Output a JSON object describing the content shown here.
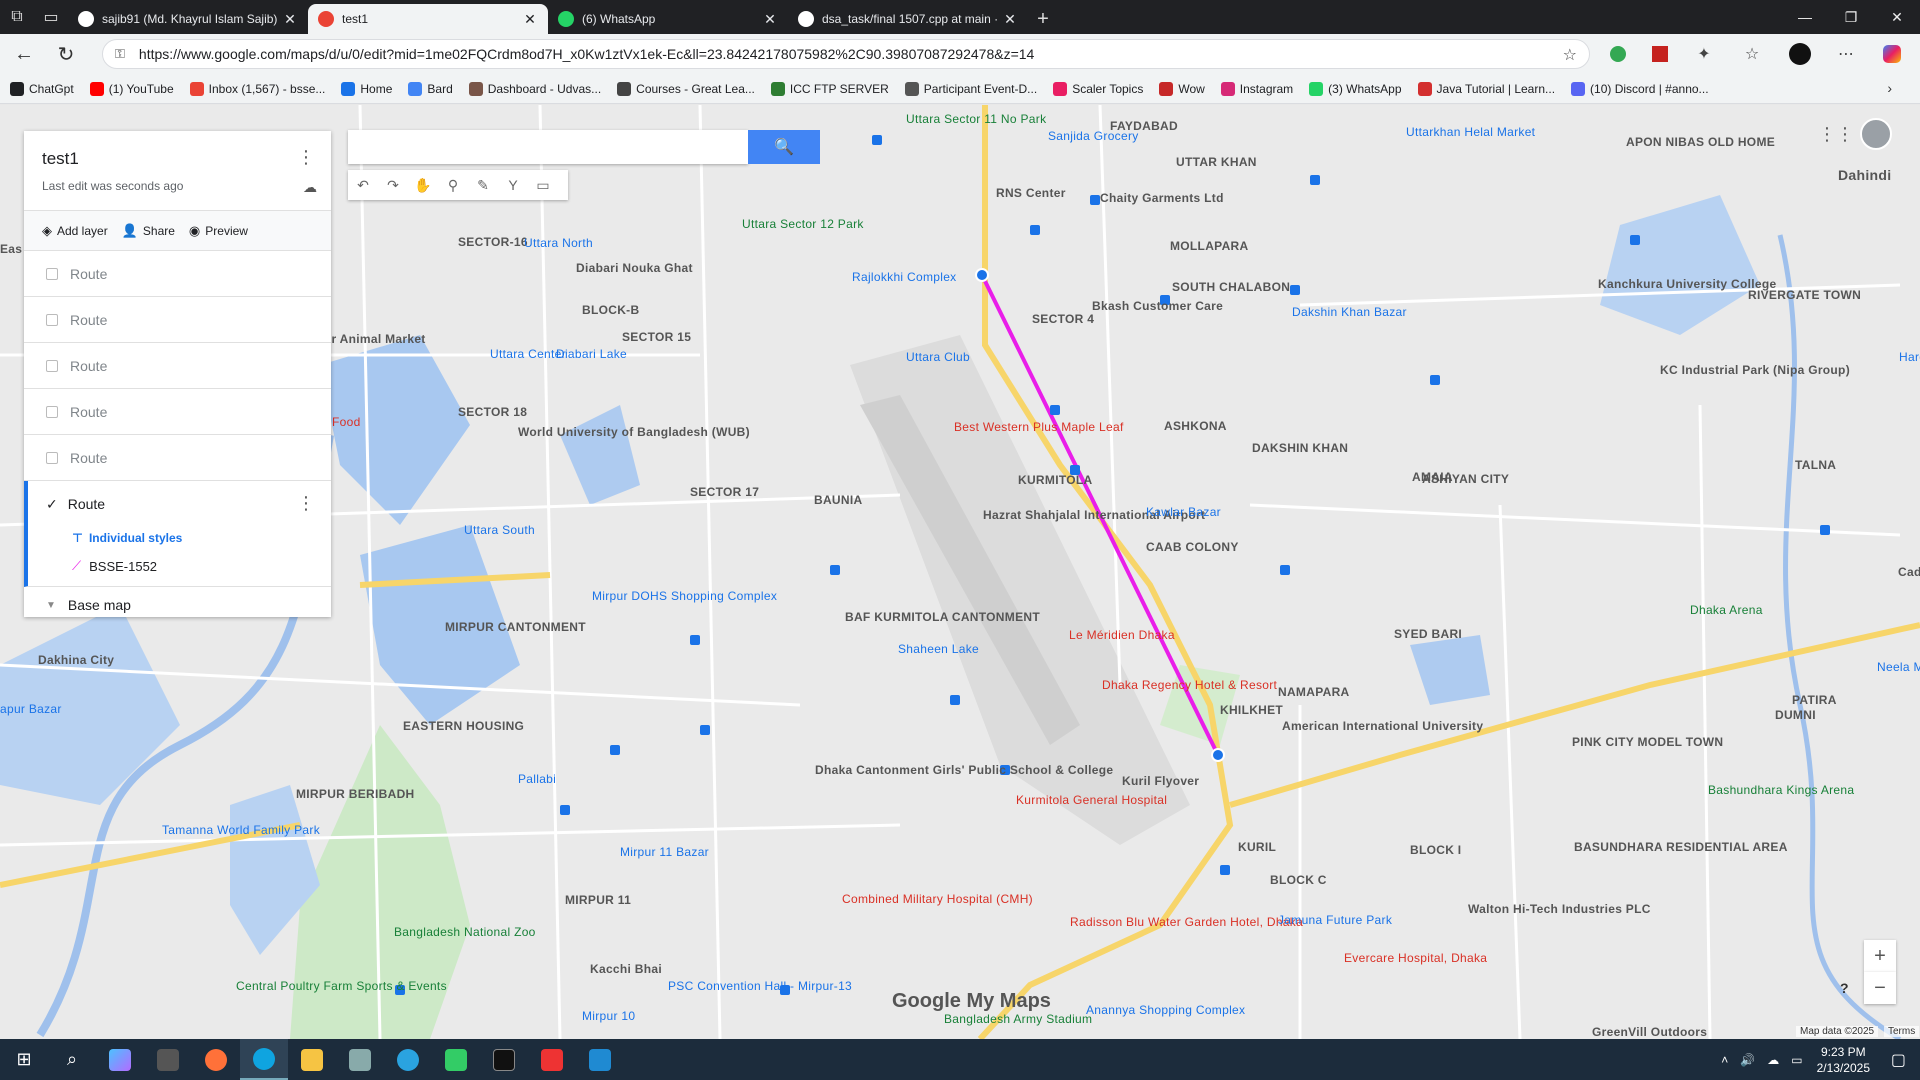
{
  "browser": {
    "tabs": [
      {
        "title": "sajib91 (Md. Khayrul Islam Sajib)",
        "icon": "github-icon",
        "color": "#ffffff",
        "active": false
      },
      {
        "title": "test1",
        "icon": "google-maps-icon",
        "color": "#ea4335",
        "active": true
      },
      {
        "title": "(6) WhatsApp",
        "icon": "whatsapp-icon",
        "color": "#25d366",
        "active": false
      },
      {
        "title": "dsa_task/final 1507.cpp at main · ",
        "icon": "github-icon",
        "color": "#ffffff",
        "active": false
      }
    ],
    "new_tab": "+",
    "url": "https://www.google.com/maps/d/u/0/edit?mid=1me02FQCrdm8od7H_x0Kw1ztVx1ek-Ec&ll=23.84242178075982%2C90.39807087292478&z=14",
    "bookmarks": [
      {
        "label": "ChatGpt",
        "color": "#202124"
      },
      {
        "label": "(1) YouTube",
        "color": "#ff0000"
      },
      {
        "label": "Inbox (1,567) - bsse...",
        "color": "#ea4335"
      },
      {
        "label": "Home",
        "color": "#1a73e8"
      },
      {
        "label": "Bard",
        "color": "#4285f4"
      },
      {
        "label": "Dashboard - Udvas...",
        "color": "#795548"
      },
      {
        "label": "Courses - Great Lea...",
        "color": "#444444"
      },
      {
        "label": "ICC FTP SERVER",
        "color": "#2e7d32"
      },
      {
        "label": "Participant Event-D...",
        "color": "#555555"
      },
      {
        "label": "Scaler Topics",
        "color": "#e91e63"
      },
      {
        "label": "Wow",
        "color": "#c62828"
      },
      {
        "label": "Instagram",
        "color": "#d62976"
      },
      {
        "label": "(3) WhatsApp",
        "color": "#25d366"
      },
      {
        "label": "Java Tutorial | Learn...",
        "color": "#d32f2f"
      },
      {
        "label": "(10) Discord | #anno...",
        "color": "#5865f2"
      }
    ]
  },
  "panel": {
    "title": "test1",
    "last_edit": "Last edit was seconds ago",
    "add_layer": "Add layer",
    "share": "Share",
    "preview": "Preview",
    "layers": [
      "Route",
      "Route",
      "Route",
      "Route",
      "Route"
    ],
    "active_layer": {
      "name": "Route",
      "style": "Individual styles",
      "feature": "BSSE-1552"
    },
    "base_map": "Base map"
  },
  "map": {
    "route_color": "#e91ee9",
    "areas": [
      {
        "text": "FAYDABAD",
        "cls": "area"
      },
      {
        "text": "UTTAR KHAN",
        "cls": "area"
      },
      {
        "text": "SECTOR-16",
        "cls": "area"
      },
      {
        "text": "BLOCK-B",
        "cls": "area"
      },
      {
        "text": "SECTOR 15",
        "cls": "area"
      },
      {
        "text": "SECTOR 4",
        "cls": "area"
      },
      {
        "text": "MOLLAPARA",
        "cls": "area"
      },
      {
        "text": "SOUTH CHALABON",
        "cls": "area"
      },
      {
        "text": "SECTOR 18",
        "cls": "area"
      },
      {
        "text": "ASHKONA",
        "cls": "area"
      },
      {
        "text": "KURMITOLA",
        "cls": "area"
      },
      {
        "text": "SECTOR 17",
        "cls": "area"
      },
      {
        "text": "BAUNIA",
        "cls": "area"
      },
      {
        "text": "CAAB COLONY",
        "cls": "area"
      },
      {
        "text": "AMAIA",
        "cls": "area"
      },
      {
        "text": "TALNA",
        "cls": "area"
      },
      {
        "text": "BAF KURMITOLA CANTONMENT",
        "cls": "area"
      },
      {
        "text": "MIRPUR CANTONMENT",
        "cls": "area"
      },
      {
        "text": "SYED BARI",
        "cls": "area"
      },
      {
        "text": "NAMAPARA",
        "cls": "area"
      },
      {
        "text": "KHILKHET",
        "cls": "area"
      },
      {
        "text": "EASTERN HOUSING",
        "cls": "area"
      },
      {
        "text": "PINK CITY MODEL TOWN",
        "cls": "area"
      },
      {
        "text": "PATIRA",
        "cls": "area"
      },
      {
        "text": "MIRPUR BERIBADH",
        "cls": "area"
      },
      {
        "text": "KURIL",
        "cls": "area"
      },
      {
        "text": "BLOCK I",
        "cls": "area"
      },
      {
        "text": "BLOCK C",
        "cls": "area"
      },
      {
        "text": "MIRPUR 11",
        "cls": "area"
      },
      {
        "text": "RIVERGATE TOWN",
        "cls": "area"
      },
      {
        "text": "Dahindi",
        "cls": "big"
      },
      {
        "text": "APON NIBAS OLD HOME",
        "cls": "area"
      }
    ],
    "pois": [
      {
        "text": "Uttara Sector 11 No Park",
        "cls": "green"
      },
      {
        "text": "Sanjida Grocery",
        "cls": "poi"
      },
      {
        "text": "Uttarkhan Helal Market",
        "cls": "poi"
      },
      {
        "text": "RNS Center",
        "cls": "area"
      },
      {
        "text": "Chaity Garments Ltd",
        "cls": "area"
      },
      {
        "text": "Uttara Sector 12 Park",
        "cls": "green"
      },
      {
        "text": "Uttara North",
        "cls": "poi"
      },
      {
        "text": "Diabari Nouka Ghat",
        "cls": "area"
      },
      {
        "text": "Rajlokkhi Complex",
        "cls": "poi"
      },
      {
        "text": "Bkash Customer Care",
        "cls": "area"
      },
      {
        "text": "Dakshin Khan Bazar",
        "cls": "poi"
      },
      {
        "text": "Kanchkura University College",
        "cls": "area"
      },
      {
        "text": "Uttara Center",
        "cls": "poi"
      },
      {
        "text": "Diabari Lake",
        "cls": "poi"
      },
      {
        "text": "Uttara Club",
        "cls": "poi"
      },
      {
        "text": "KC Industrial Park (Nipa Group)",
        "cls": "area"
      },
      {
        "text": "Best Western Plus Maple Leaf",
        "cls": "red"
      },
      {
        "text": "World University of Bangladesh (WUB)",
        "cls": "area"
      },
      {
        "text": "DAKSHIN KHAN",
        "cls": "area"
      },
      {
        "text": "ASHIYAN CITY",
        "cls": "area"
      },
      {
        "text": "Hazrat Shahjalal International Airport",
        "cls": "area"
      },
      {
        "text": "Kawlar Bazar",
        "cls": "poi"
      },
      {
        "text": "Uttara South",
        "cls": "poi"
      },
      {
        "text": "Mirpur DOHS Shopping Complex",
        "cls": "poi"
      },
      {
        "text": "Le Méridien Dhaka",
        "cls": "red"
      },
      {
        "text": "Dhaka Arena",
        "cls": "green"
      },
      {
        "text": "Dakhina City",
        "cls": "area"
      },
      {
        "text": "Shaheen Lake",
        "cls": "poi"
      },
      {
        "text": "Dhaka Regency Hotel & Resort",
        "cls": "red"
      },
      {
        "text": "American International University",
        "cls": "area"
      },
      {
        "text": "Pallabi",
        "cls": "poi"
      },
      {
        "text": "Dhaka Cantonment Girls' Public School & College",
        "cls": "area"
      },
      {
        "text": "Kurmitola General Hospital",
        "cls": "red"
      },
      {
        "text": "Kuril Flyover",
        "cls": "area"
      },
      {
        "text": "Bashundhara Kings Arena",
        "cls": "green"
      },
      {
        "text": "Tamanna World Family Park",
        "cls": "poi"
      },
      {
        "text": "Mirpur 11 Bazar",
        "cls": "poi"
      },
      {
        "text": "Combined Military Hospital (CMH)",
        "cls": "red"
      },
      {
        "text": "Radisson Blu Water Garden Hotel, Dhaka",
        "cls": "red"
      },
      {
        "text": "Jamuna Future Park",
        "cls": "poi"
      },
      {
        "text": "Walton Hi-Tech Industries PLC",
        "cls": "area"
      },
      {
        "text": "Bangladesh National Zoo",
        "cls": "green"
      },
      {
        "text": "Kacchi Bhai",
        "cls": "area"
      },
      {
        "text": "Evercare Hospital, Dhaka",
        "cls": "red"
      },
      {
        "text": "Central Poultry Farm Sports & Events",
        "cls": "green"
      },
      {
        "text": "PSC Convention Hall - Mirpur-13",
        "cls": "poi"
      },
      {
        "text": "Mirpur 10",
        "cls": "poi"
      },
      {
        "text": "Bangladesh Army Stadium",
        "cls": "green"
      },
      {
        "text": "Anannya Shopping Complex",
        "cls": "poi"
      },
      {
        "text": "BASUNDHARA RESIDENTIAL AREA",
        "cls": "area"
      },
      {
        "text": "GreenVill Outdoors",
        "cls": "area"
      },
      {
        "text": "ratpur Animal Market",
        "cls": "area"
      },
      {
        "text": "Food",
        "cls": "red"
      },
      {
        "text": "apur Bazar",
        "cls": "poi"
      },
      {
        "text": "Harding",
        "cls": "poi"
      },
      {
        "text": "Cade",
        "cls": "area"
      },
      {
        "text": "Neela M",
        "cls": "poi"
      },
      {
        "text": "DUMNI",
        "cls": "area"
      },
      {
        "text": "Eas",
        "cls": "area"
      }
    ],
    "attribution": "Map data ©2025",
    "terms": "Terms",
    "logo": "Google My Maps"
  },
  "taskbar": {
    "time": "9:23 PM",
    "date": "2/13/2025"
  }
}
